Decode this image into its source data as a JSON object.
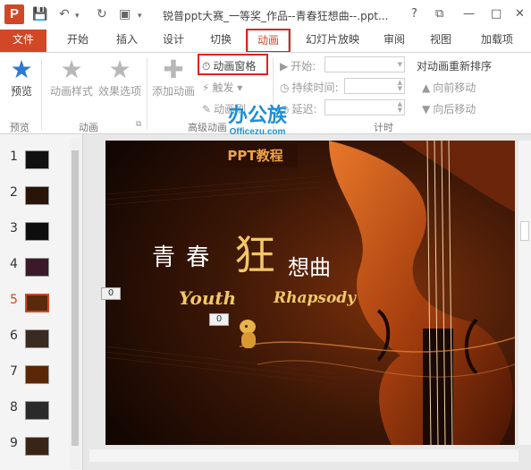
{
  "window": {
    "title": "锐普ppt大赛_一等奖_作品--青春狂想曲--.ppt...",
    "app_icon_letter": "P",
    "help": "?",
    "restore": "⧉",
    "minimize": "—",
    "maximize": "□",
    "close": "✕"
  },
  "qat": {
    "save": "💾",
    "undo": "↶",
    "redo": "↻"
  },
  "tabs": {
    "file": "文件",
    "home": "开始",
    "insert": "插入",
    "design": "设计",
    "transitions": "切换",
    "animations": "动画",
    "slideshow": "幻灯片放映",
    "review": "审阅",
    "view": "视图",
    "addins": "加载项"
  },
  "ribbon": {
    "preview": "预览",
    "animation_styles": "动画样式",
    "effect_options": "效果选项",
    "add_animation": "添加动画",
    "animation_pane": "动画窗格",
    "trigger": "触发",
    "animation_painter": "动画刷",
    "start_label": "开始:",
    "duration_label": "持续时间:",
    "delay_label": "延迟:",
    "reorder_title": "对动画重新排序",
    "move_earlier": "向前移动",
    "move_later": "向后移动",
    "group_preview": "预览",
    "group_animation": "动画",
    "group_advanced": "高级动画",
    "group_timing": "计时"
  },
  "watermark": {
    "line1": "办公族",
    "line2": "Officezu.com"
  },
  "slides": {
    "numbers": [
      "1",
      "2",
      "3",
      "4",
      "5",
      "6",
      "7",
      "8",
      "9"
    ],
    "selected_index": 5
  },
  "slide": {
    "banner": "PPT教程",
    "title_part1": "青 春",
    "title_big": "狂",
    "title_part2": "想曲",
    "subtitle_left": "Youth",
    "subtitle_right": "Rhapsody",
    "anim_tag_1": "0",
    "anim_tag_2": "0"
  },
  "colors": {
    "accent": "#d24726",
    "highlight_box": "#e0241b",
    "slide_bg": "#3a1606",
    "gold_text": "#f2c867"
  }
}
